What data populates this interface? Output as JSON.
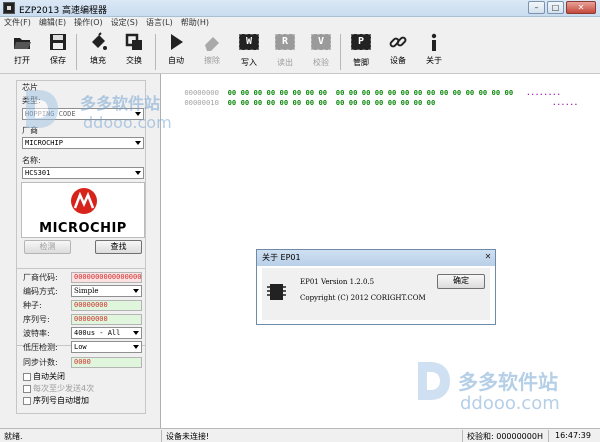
{
  "window": {
    "title": "EZP2013 高速编程器"
  },
  "menu": [
    "文件(F)",
    "编辑(E)",
    "操作(O)",
    "设定(S)",
    "语言(L)",
    "帮助(H)"
  ],
  "toolbar": {
    "open": "打开",
    "save": "保存",
    "fill": "填充",
    "swap": "交换",
    "auto": "自动",
    "erase": "擦除",
    "write": "写入",
    "read": "读出",
    "verify": "校验",
    "pins": "管脚",
    "device": "设备",
    "about": "关于",
    "write_letter": "W",
    "read_letter": "R",
    "verify_letter": "V",
    "pins_letter": "P"
  },
  "chip_panel": {
    "chip_label": "芯片",
    "type_label": "类型:",
    "type_value": "HOPPING CODE",
    "vendor_label": "厂商",
    "vendor_value": "MICROCHIP",
    "name_label": "名称:",
    "name_value": "HCS301",
    "logo_text": "MICROCHIP",
    "detect_button": "检测",
    "find_button": "查找"
  },
  "params_panel": {
    "vendor_code_label": "厂商代码:",
    "vendor_code_value": "0000000000000000",
    "encoding_label": "编码方式:",
    "encoding_value": "Simple",
    "seed_label": "种子:",
    "seed_value": "00000000",
    "serial_label": "序列号:",
    "serial_value": "00000000",
    "baud_label": "波特率:",
    "baud_value": "400us - All",
    "lowv_label": "低压检测:",
    "lowv_value": "Low",
    "sync_label": "同步计数:",
    "sync_value": "0000",
    "auto_close": "自动关闭",
    "min_send": "每次至少发送4次",
    "auto_serial": "序列号自动增加"
  },
  "hex": {
    "rows": [
      {
        "addr": "00000000",
        "bytes": "00 00 00 00 00 00 00 00  00 00 00 00 00 00 00 00 00 00 00 00 00 00",
        "ascii": "........"
      },
      {
        "addr": "00000010",
        "bytes": "00 00 00 00 00 00 00 00  00 00 00 00 00 00 00 00",
        "ascii": "......"
      }
    ]
  },
  "about_dialog": {
    "title": "关于 EP01",
    "close": "✕",
    "version": "EP01 Version 1.2.0.5",
    "copyright": "Copyright (C) 2012 CORIGHT.COM",
    "ok_button": "确定"
  },
  "status": {
    "ready": "就绪.",
    "device_status": "设备未连接!",
    "checksum": "校验和: 00000000H",
    "time": "16:47:39"
  },
  "watermark": {
    "cn": "多多软件站",
    "en": "ddooo.com"
  }
}
